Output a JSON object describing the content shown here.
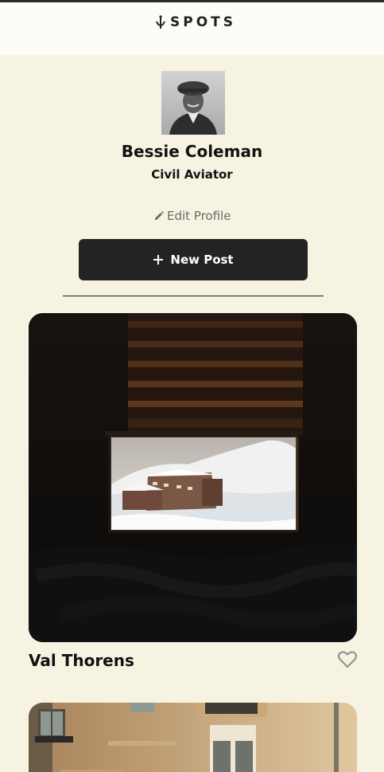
{
  "app": {
    "logo_text": "SPOTS"
  },
  "profile": {
    "name": "Bessie Coleman",
    "role": "Civil Aviator",
    "edit_label": "Edit Profile"
  },
  "actions": {
    "new_post_label": "New Post"
  },
  "posts": [
    {
      "title": "Val Thorens",
      "liked": false
    },
    {
      "title": "",
      "liked": false
    }
  ],
  "colors": {
    "background": "#f7f3e3",
    "header": "#fdfcf7",
    "button": "#232323",
    "muted_text": "#6b6a66"
  },
  "icons": {
    "logo": "sprout-icon",
    "edit": "pencil-icon",
    "add": "plus-icon",
    "like": "heart-outline-icon"
  }
}
